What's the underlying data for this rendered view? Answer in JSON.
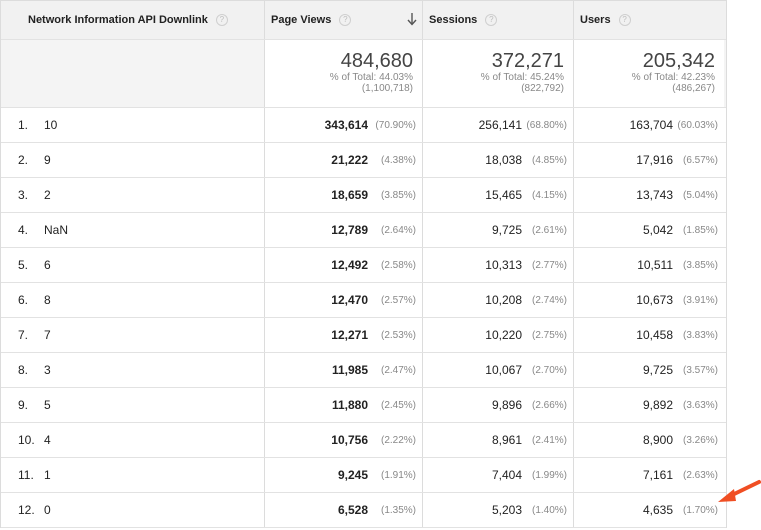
{
  "headers": {
    "dimension": "Network Information API Downlink",
    "pageviews": "Page Views",
    "sessions": "Sessions",
    "users": "Users",
    "help_glyph": "?"
  },
  "totals": {
    "pageviews": {
      "value": "484,680",
      "pct": "% of Total: 44.03%",
      "total": "(1,100,718)"
    },
    "sessions": {
      "value": "372,271",
      "pct": "% of Total: 45.24%",
      "total": "(822,792)"
    },
    "users": {
      "value": "205,342",
      "pct": "% of Total: 42.23%",
      "total": "(486,267)"
    }
  },
  "rows": [
    {
      "idx": "1.",
      "dim": "10",
      "pv": "343,614",
      "pv_pct": "(70.90%)",
      "s": "256,141",
      "s_pct": "(68.80%)",
      "u": "163,704",
      "u_pct": "(60.03%)"
    },
    {
      "idx": "2.",
      "dim": "9",
      "pv": "21,222",
      "pv_pct": "(4.38%)",
      "s": "18,038",
      "s_pct": "(4.85%)",
      "u": "17,916",
      "u_pct": "(6.57%)"
    },
    {
      "idx": "3.",
      "dim": "2",
      "pv": "18,659",
      "pv_pct": "(3.85%)",
      "s": "15,465",
      "s_pct": "(4.15%)",
      "u": "13,743",
      "u_pct": "(5.04%)"
    },
    {
      "idx": "4.",
      "dim": "NaN",
      "pv": "12,789",
      "pv_pct": "(2.64%)",
      "s": "9,725",
      "s_pct": "(2.61%)",
      "u": "5,042",
      "u_pct": "(1.85%)"
    },
    {
      "idx": "5.",
      "dim": "6",
      "pv": "12,492",
      "pv_pct": "(2.58%)",
      "s": "10,313",
      "s_pct": "(2.77%)",
      "u": "10,511",
      "u_pct": "(3.85%)"
    },
    {
      "idx": "6.",
      "dim": "8",
      "pv": "12,470",
      "pv_pct": "(2.57%)",
      "s": "10,208",
      "s_pct": "(2.74%)",
      "u": "10,673",
      "u_pct": "(3.91%)"
    },
    {
      "idx": "7.",
      "dim": "7",
      "pv": "12,271",
      "pv_pct": "(2.53%)",
      "s": "10,220",
      "s_pct": "(2.75%)",
      "u": "10,458",
      "u_pct": "(3.83%)"
    },
    {
      "idx": "8.",
      "dim": "3",
      "pv": "11,985",
      "pv_pct": "(2.47%)",
      "s": "10,067",
      "s_pct": "(2.70%)",
      "u": "9,725",
      "u_pct": "(3.57%)"
    },
    {
      "idx": "9.",
      "dim": "5",
      "pv": "11,880",
      "pv_pct": "(2.45%)",
      "s": "9,896",
      "s_pct": "(2.66%)",
      "u": "9,892",
      "u_pct": "(3.63%)"
    },
    {
      "idx": "10.",
      "dim": "4",
      "pv": "10,756",
      "pv_pct": "(2.22%)",
      "s": "8,961",
      "s_pct": "(2.41%)",
      "u": "8,900",
      "u_pct": "(3.26%)"
    },
    {
      "idx": "11.",
      "dim": "1",
      "pv": "9,245",
      "pv_pct": "(1.91%)",
      "s": "7,404",
      "s_pct": "(1.99%)",
      "u": "7,161",
      "u_pct": "(2.63%)"
    },
    {
      "idx": "12.",
      "dim": "0",
      "pv": "6,528",
      "pv_pct": "(1.35%)",
      "s": "5,203",
      "s_pct": "(1.40%)",
      "u": "4,635",
      "u_pct": "(1.70%)"
    }
  ],
  "annotation": {
    "arrow_color": "#f04e23"
  },
  "icons": {
    "sort": "arrow-down-icon",
    "help": "help-icon",
    "callout": "red-arrow-icon"
  }
}
